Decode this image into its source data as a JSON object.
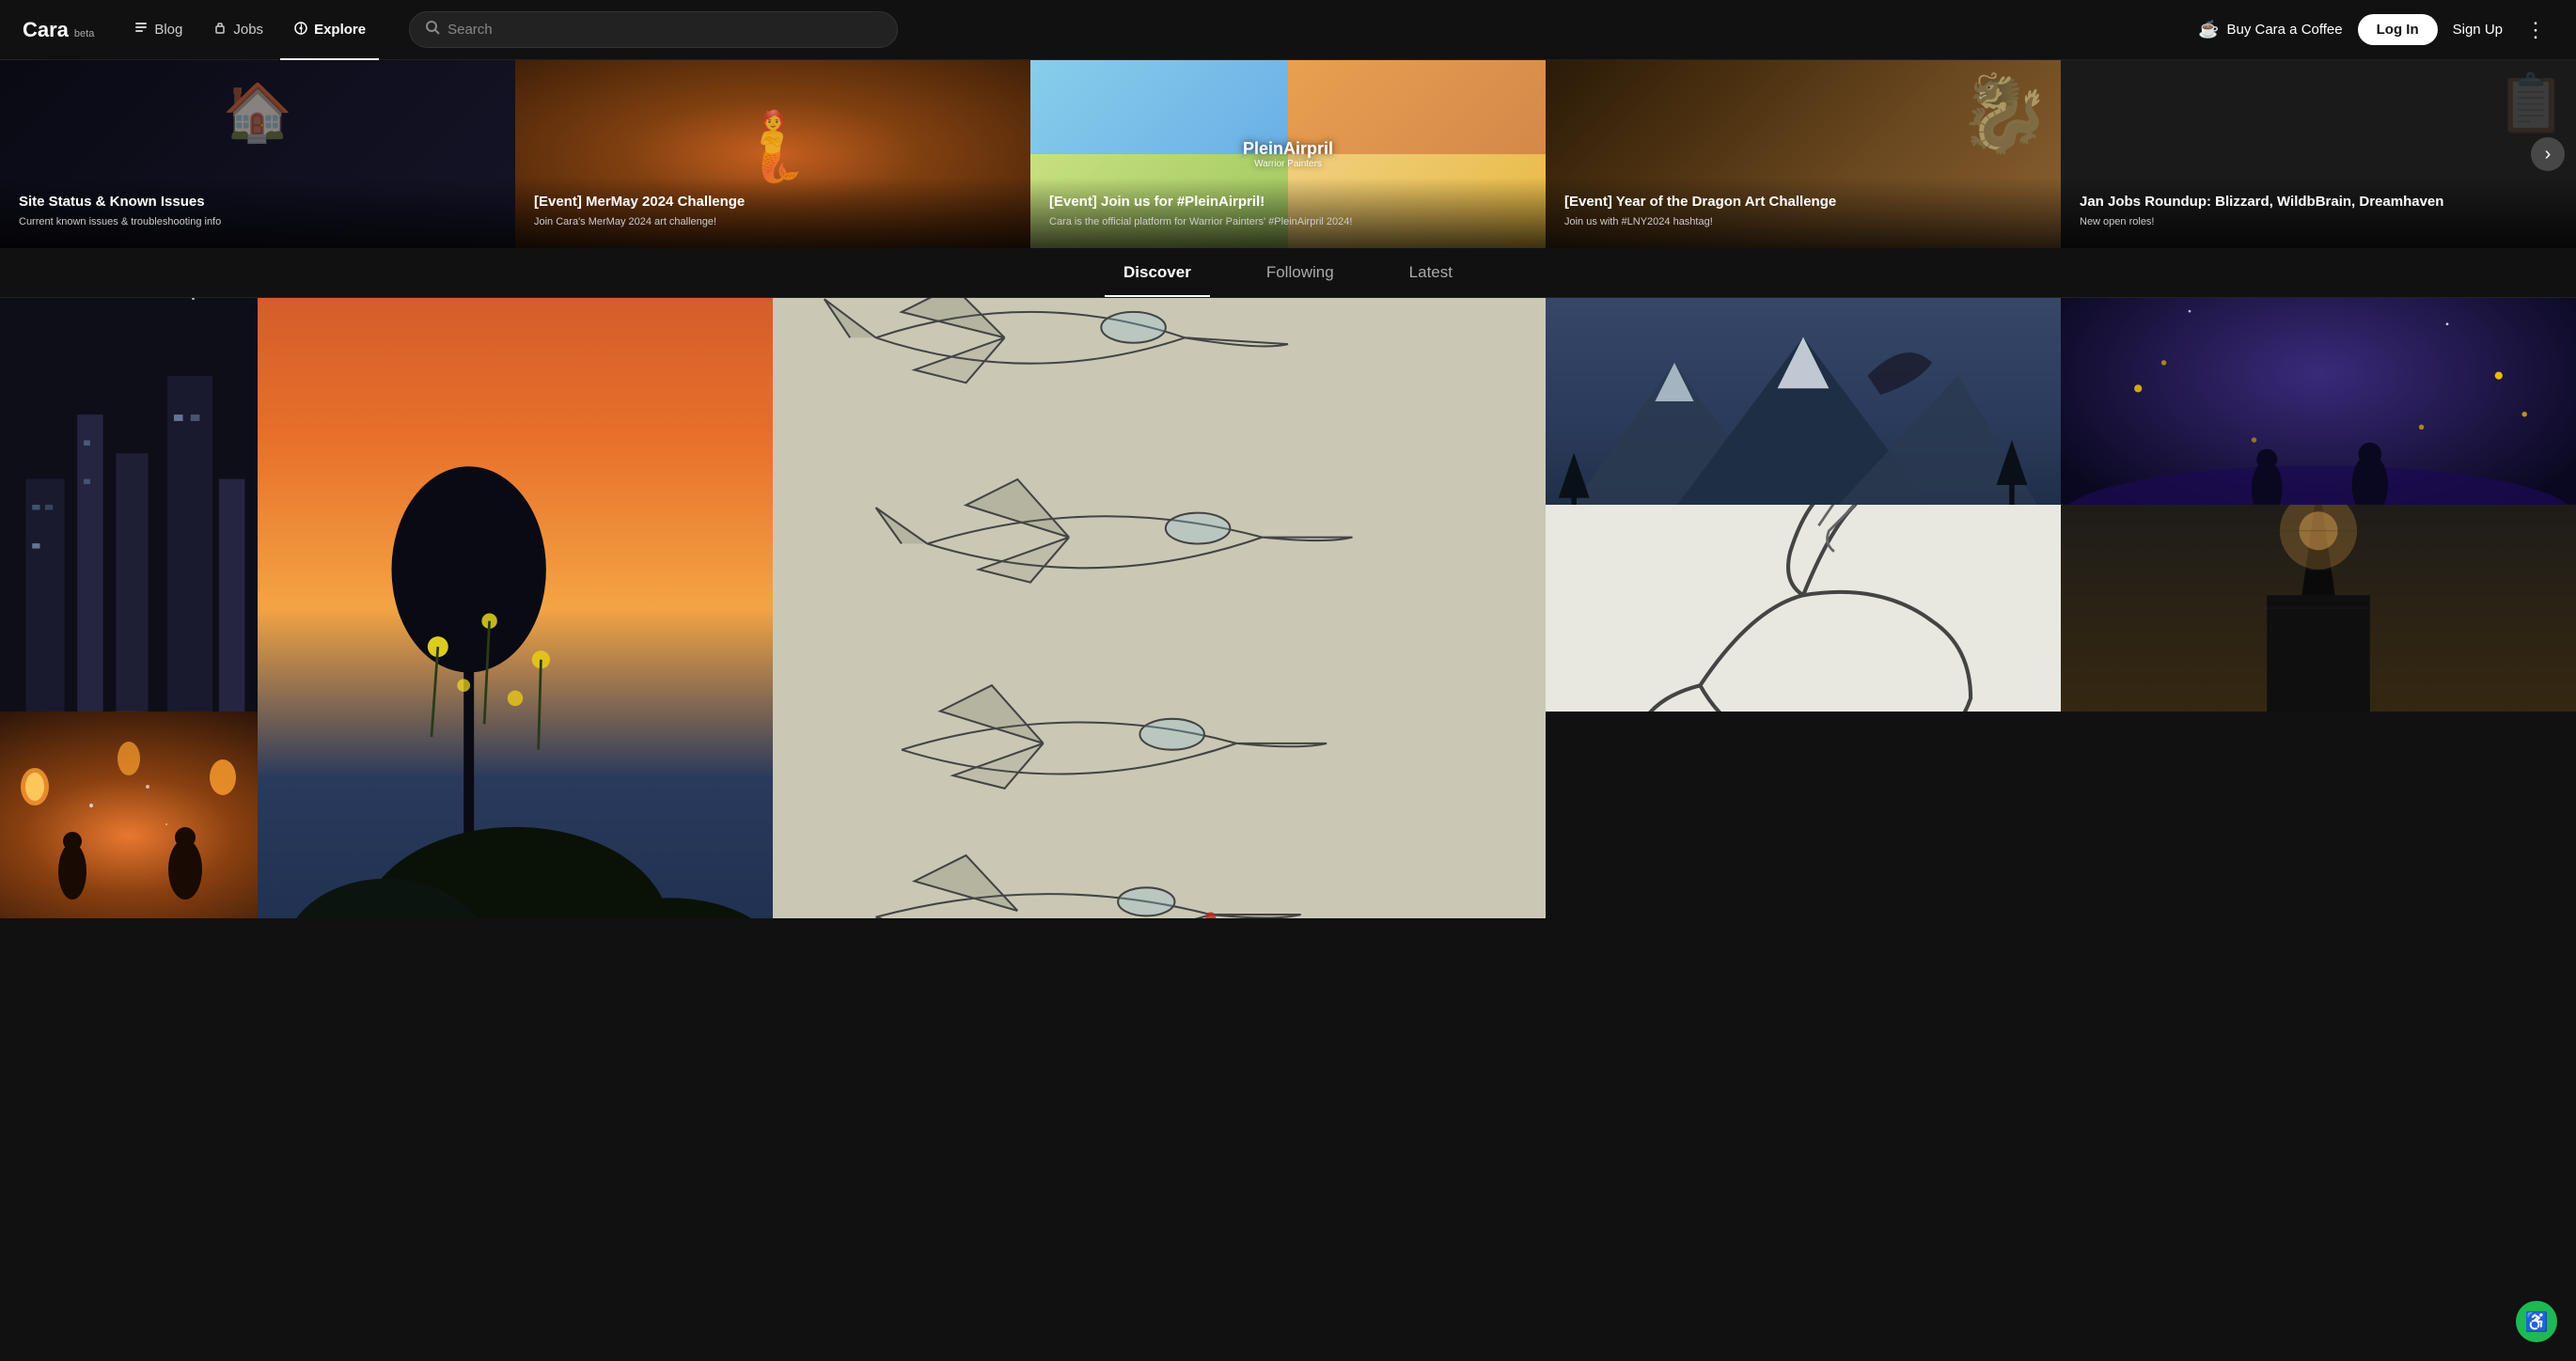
{
  "site": {
    "logo": "Cara",
    "logo_beta": "beta"
  },
  "navbar": {
    "blog_label": "Blog",
    "jobs_label": "Jobs",
    "explore_label": "Explore",
    "search_placeholder": "Search",
    "buy_coffee_label": "Buy Cara a Coffee",
    "login_label": "Log In",
    "signup_label": "Sign Up"
  },
  "banner_cards": [
    {
      "id": "site-status",
      "title": "Site Status & Known Issues",
      "subtitle": "Current known issues & troubleshooting info"
    },
    {
      "id": "mermay",
      "title": "[Event] MerMay 2024 Challenge",
      "subtitle": "Join Cara's MerMay 2024 art challenge!"
    },
    {
      "id": "pleinairpril",
      "title": "[Event] Join us for #PleinAirpril!",
      "subtitle": "Cara is the official platform for Warrior Painters' #PleinAirpril 2024!",
      "watermark": "PleinAirpril",
      "watermark_sub": "Warrior Painters"
    },
    {
      "id": "dragon",
      "title": "[Event] Year of the Dragon Art Challenge",
      "subtitle": "Join us with #LNY2024 hashtag!"
    },
    {
      "id": "janjobs",
      "title": "Jan Jobs Roundup: Blizzard, WildbBrain, Dreamhaven",
      "subtitle": "New open roles!"
    }
  ],
  "tabs": [
    {
      "id": "discover",
      "label": "Discover"
    },
    {
      "id": "following",
      "label": "Following"
    },
    {
      "id": "latest",
      "label": "Latest"
    }
  ],
  "active_tab": "discover",
  "accessibility_btn_label": "♿"
}
